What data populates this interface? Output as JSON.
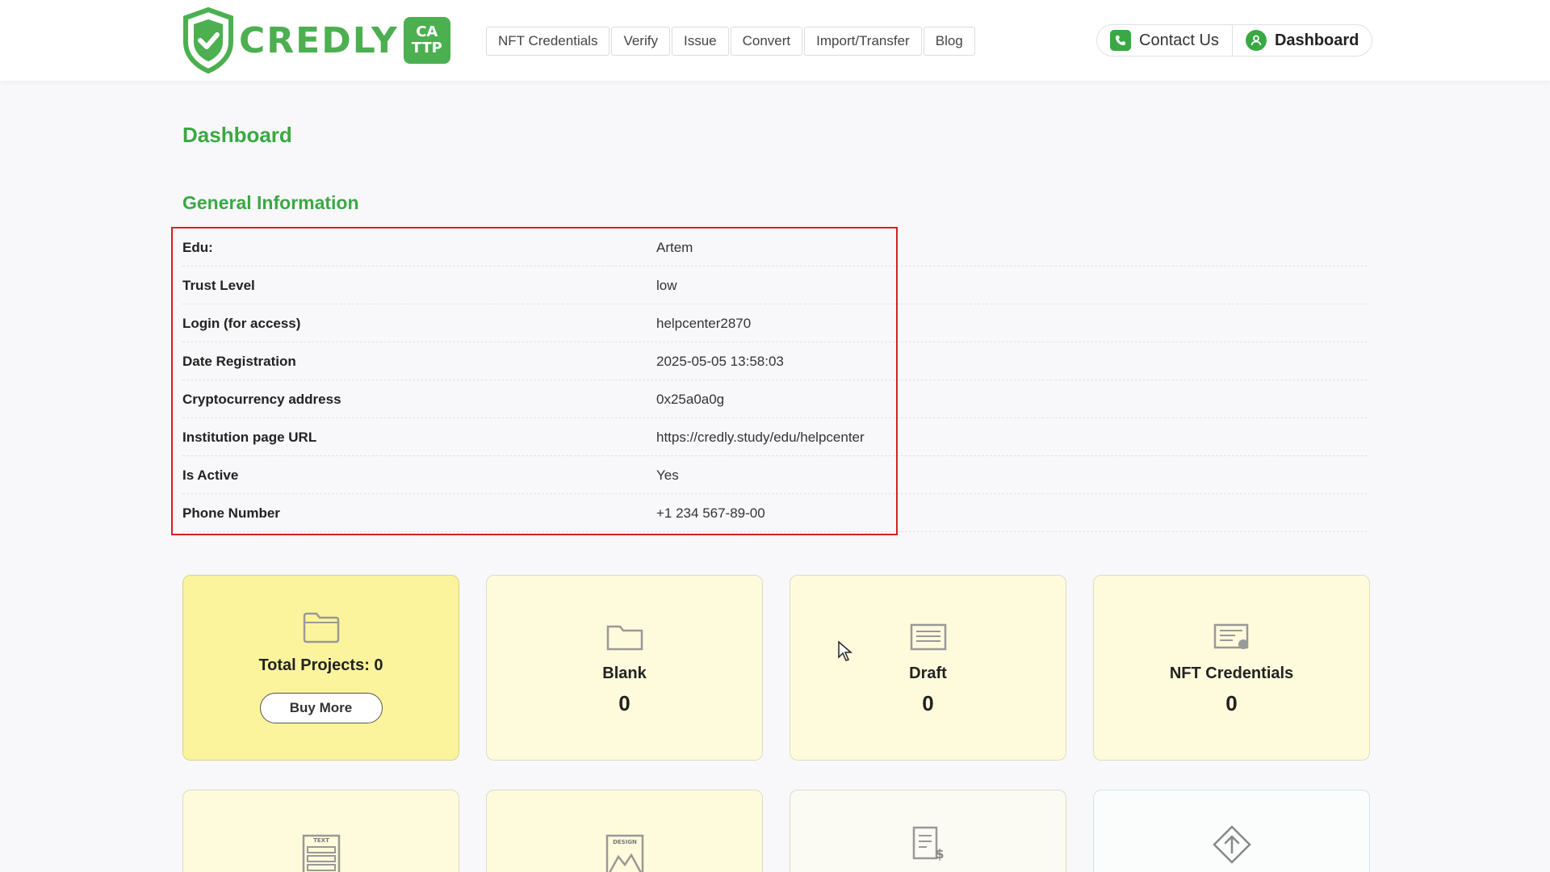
{
  "logo": {
    "word": "CREDLY",
    "badge_top": "CA",
    "badge_bottom": "TTP"
  },
  "nav": [
    "NFT Credentials",
    "Verify",
    "Issue",
    "Convert",
    "Import/Transfer",
    "Blog"
  ],
  "actions": {
    "contact": "Contact Us",
    "dashboard": "Dashboard"
  },
  "page_title": "Dashboard",
  "section_title": "General Information",
  "info": [
    {
      "label": "Edu:",
      "value": "Artem"
    },
    {
      "label": "Trust Level",
      "value": "low"
    },
    {
      "label": "Login (for access)",
      "value": "helpcenter2870"
    },
    {
      "label": "Date Registration",
      "value": "2025-05-05 13:58:03"
    },
    {
      "label": "Cryptocurrency address",
      "value": "0x25a0a0g"
    },
    {
      "label": "Institution page URL",
      "value": "https://credly.study/edu/helpcenter"
    },
    {
      "label": "Is Active",
      "value": "Yes"
    },
    {
      "label": "Phone Number",
      "value": "+1 234 567-89-00"
    }
  ],
  "cards": {
    "total_projects": "Total Projects: 0",
    "buy_more": "Buy More",
    "blank": {
      "label": "Blank",
      "count": "0"
    },
    "draft": {
      "label": "Draft",
      "count": "0"
    },
    "nft": {
      "label": "NFT Credentials",
      "count": "0"
    },
    "text_icon_label": "TEXT",
    "design_icon_label": "DESIGN"
  },
  "colors": {
    "brand_green": "#3aa843",
    "card_yellow": "#fdfbdc",
    "card_active": "#fcf49c",
    "highlight_red": "#d61f26"
  }
}
